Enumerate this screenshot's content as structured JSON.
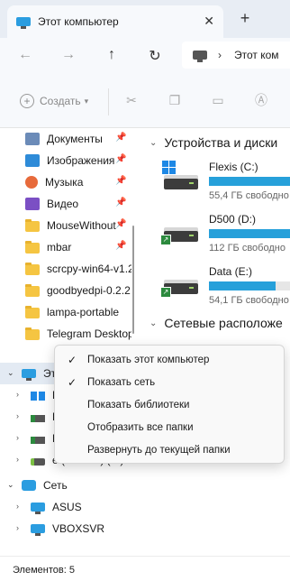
{
  "window": {
    "tab_title": "Этот компьютер",
    "tab_close": "✕",
    "new_tab": "+"
  },
  "address": {
    "separator": "›",
    "crumb": "Этот ком"
  },
  "toolbar": {
    "create_label": "Создать",
    "create_plus": "+",
    "create_caret": "▾"
  },
  "sidebar": {
    "quick_access": [
      {
        "label": "Документы",
        "icon": "documents-icon",
        "pinned": true
      },
      {
        "label": "Изображения",
        "icon": "pictures-icon",
        "pinned": true
      },
      {
        "label": "Музыка",
        "icon": "music-icon",
        "pinned": true
      },
      {
        "label": "Видео",
        "icon": "video-icon",
        "pinned": true
      },
      {
        "label": "MouseWithout",
        "icon": "folder-icon",
        "pinned": true
      },
      {
        "label": "mbar",
        "icon": "folder-icon",
        "pinned": true
      },
      {
        "label": "scrcpy-win64-v1.2",
        "icon": "folder-icon",
        "pinned": false
      },
      {
        "label": "goodbyedpi-0.2.2",
        "icon": "folder-icon",
        "pinned": false
      },
      {
        "label": "lampa-portable",
        "icon": "folder-icon",
        "pinned": false
      },
      {
        "label": "Telegram Desktop",
        "icon": "folder-icon",
        "pinned": false
      }
    ],
    "this_pc_label": "Эт",
    "this_pc_children": [
      {
        "label": "F",
        "icon": "flexis-drive-icon"
      },
      {
        "label": "D",
        "icon": "network-drive-icon"
      },
      {
        "label": "D",
        "icon": "network-drive-icon"
      },
      {
        "label": "e (\\\\ASUS) (Z:)",
        "icon": "drive-icon"
      }
    ],
    "network_label": "Сеть",
    "network_children": [
      {
        "label": "ASUS",
        "icon": "computer-icon"
      },
      {
        "label": "VBOXSVR",
        "icon": "computer-icon"
      }
    ],
    "pin_glyph": "📌",
    "expand_glyph": "›",
    "expanded_glyph": "⌄"
  },
  "content": {
    "devices_title": "Устройства и диски",
    "network_title": "Сетевые расположе",
    "section_caret": "⌄",
    "drives": [
      {
        "name": "Flexis (C:)",
        "free": "55,4 ГБ свободно",
        "used_fraction": 0.85,
        "kind": "system"
      },
      {
        "name": "D500 (D:)",
        "free": "112 ГБ свободно",
        "used_fraction": 0.78,
        "kind": "shared"
      },
      {
        "name": "Data (E:)",
        "free": "54,1 ГБ свободно",
        "used_fraction": 0.62,
        "kind": "shared"
      }
    ]
  },
  "statusbar": {
    "items_count": "Элементов: 5"
  },
  "context_menu": {
    "items": [
      {
        "label": "Показать этот компьютер",
        "checked": true
      },
      {
        "label": "Показать сеть",
        "checked": true
      },
      {
        "label": "Показать библиотеки",
        "checked": false
      },
      {
        "label": "Отобразить все папки",
        "checked": false
      },
      {
        "label": "Развернуть до текущей папки",
        "checked": false
      }
    ],
    "check_glyph": "✓"
  },
  "colors": {
    "accent": "#26a0da",
    "folder": "#f5c542",
    "tabbar_bg": "#e8edf4",
    "chrome_bg": "#f7f9fc"
  }
}
